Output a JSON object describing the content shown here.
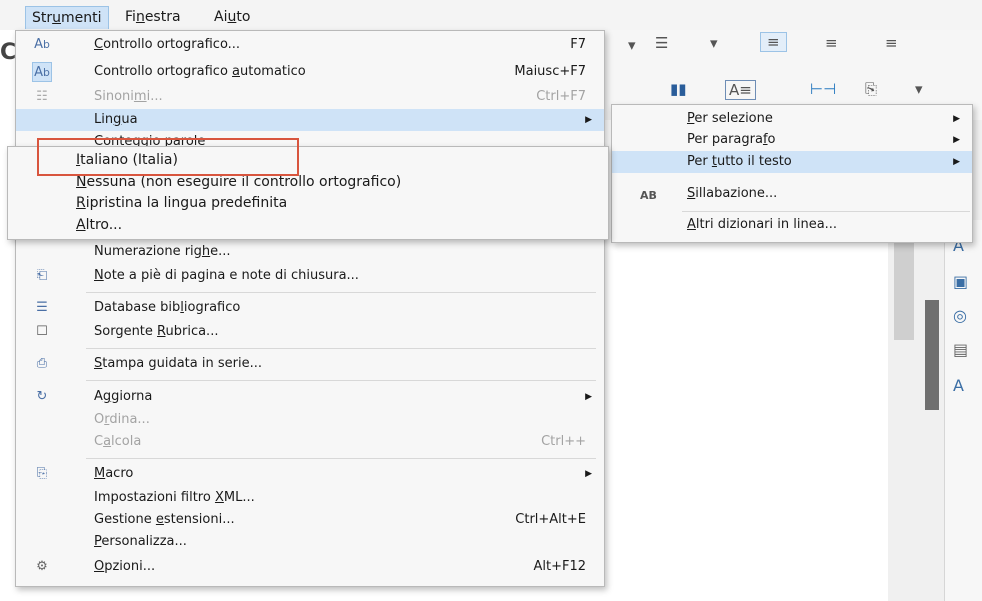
{
  "menubar": {
    "items": [
      {
        "label": "Strumenti"
      },
      {
        "label": "Finestra"
      },
      {
        "label": "Aiuto"
      }
    ]
  },
  "background": {
    "partial_glyph": "C"
  },
  "tools_menu": {
    "items": [
      {
        "label": "Controllo ortografico...",
        "shortcut": "F7",
        "icon": "spellcheck-icon",
        "glyph": "A⁃"
      },
      {
        "label": "Controllo ortografico automatico",
        "shortcut": "Maiusc+F7",
        "icon": "auto-spellcheck-icon",
        "glyph": "A⁃"
      },
      {
        "label": "Sinonimi...",
        "shortcut": "Ctrl+F7",
        "icon": "thesaurus-icon",
        "glyph": "☷",
        "disabled": true
      },
      {
        "label": "Lingua",
        "icon": "",
        "submenu": true
      },
      {
        "label": "Conteggio parole",
        "icon": "word-count-icon"
      },
      {
        "label": "Numerazione righe...",
        "icon": ""
      },
      {
        "label": "Note a piè di pagina e note di chiusura...",
        "icon": "footnote-icon",
        "glyph": "⎗"
      },
      {
        "label": "Database bibliografico",
        "icon": "bibliography-icon",
        "glyph": "☰"
      },
      {
        "label": "Sorgente Rubrica...",
        "icon": "address-book-icon",
        "glyph": "☐"
      },
      {
        "label": "Stampa guidata in serie...",
        "icon": "mail-merge-icon",
        "glyph": "⎙"
      },
      {
        "label": "Aggiorna",
        "icon": "refresh-icon",
        "glyph": "↻",
        "submenu": true
      },
      {
        "label": "Ordina...",
        "disabled": true
      },
      {
        "label": "Calcola",
        "shortcut": "Ctrl++",
        "disabled": true
      },
      {
        "label": "Macro",
        "icon": "macro-icon",
        "glyph": "⎘",
        "submenu": true
      },
      {
        "label": "Impostazioni filtro XML..."
      },
      {
        "label": "Gestione estensioni...",
        "shortcut": "Ctrl+Alt+E"
      },
      {
        "label": "Personalizza..."
      },
      {
        "label": "Opzioni...",
        "shortcut": "Alt+F12",
        "icon": "options-gear-icon",
        "glyph": "⚙"
      }
    ]
  },
  "language_submenu": {
    "items": [
      {
        "label": "Per selezione"
      },
      {
        "label": "Per paragrafo"
      },
      {
        "label": "Per tutto il testo"
      },
      {
        "label": "Sillabazione...",
        "icon": "hyphenation-icon",
        "glyph": "AB"
      },
      {
        "label": "Altri dizionari in linea..."
      }
    ]
  },
  "whole_text_submenu": {
    "items": [
      {
        "label": "Italiano (Italia)"
      },
      {
        "label": "Nessuna (non eseguire il controllo ortografico)"
      },
      {
        "label": "Ripristina la lingua predefinita"
      },
      {
        "label": "Altro..."
      }
    ]
  },
  "colors": {
    "highlight": "#cfe3f7",
    "annotation_box": "#d8553e"
  }
}
